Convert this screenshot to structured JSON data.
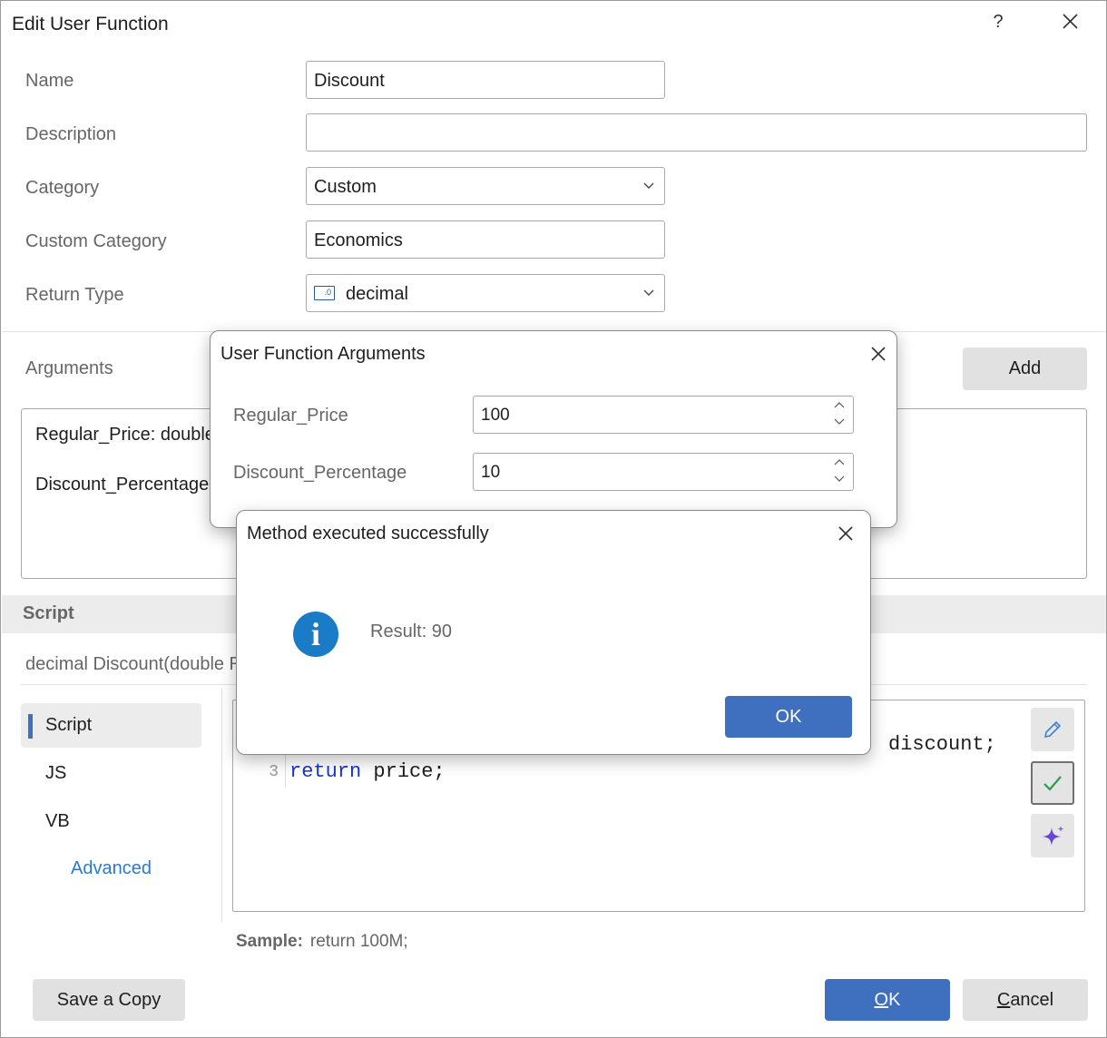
{
  "window": {
    "title": "Edit User Function",
    "help_label": "?"
  },
  "form": {
    "name_label": "Name",
    "name_value": "Discount",
    "description_label": "Description",
    "description_value": "",
    "category_label": "Category",
    "category_value": "Custom",
    "custom_category_label": "Custom Category",
    "custom_category_value": "Economics",
    "return_type_label": "Return Type",
    "return_type_value": "decimal",
    "return_type_icon_text": ".0"
  },
  "arguments": {
    "label": "Arguments",
    "add_label": "Add",
    "items": [
      "Regular_Price: double",
      "Discount_Percentage:"
    ]
  },
  "script": {
    "header": "Script",
    "signature": "decimal Discount(double R",
    "tabs": [
      "Script",
      "JS",
      "VB"
    ],
    "advanced_label": "Advanced",
    "line2_tail": "discount;",
    "line3_number": "3",
    "line3_keyword": "return",
    "line3_rest": " price;",
    "sample_label": "Sample:",
    "sample_value": "return 100M;"
  },
  "footer": {
    "save_copy_label": "Save a Copy",
    "ok_label": "OK",
    "cancel_label": "Cancel"
  },
  "args_dialog": {
    "title": "User Function Arguments",
    "fields": [
      {
        "label": "Regular_Price",
        "value": "100"
      },
      {
        "label": "Discount_Percentage",
        "value": "10"
      }
    ]
  },
  "result_dialog": {
    "title": "Method executed successfully",
    "message": "Result: 90",
    "ok_label": "OK",
    "icon_glyph": "i"
  },
  "colors": {
    "accent": "#3f6fbf",
    "info_icon": "#1a7bc6",
    "link": "#2a7ad0",
    "keyword": "#1a36c8"
  }
}
